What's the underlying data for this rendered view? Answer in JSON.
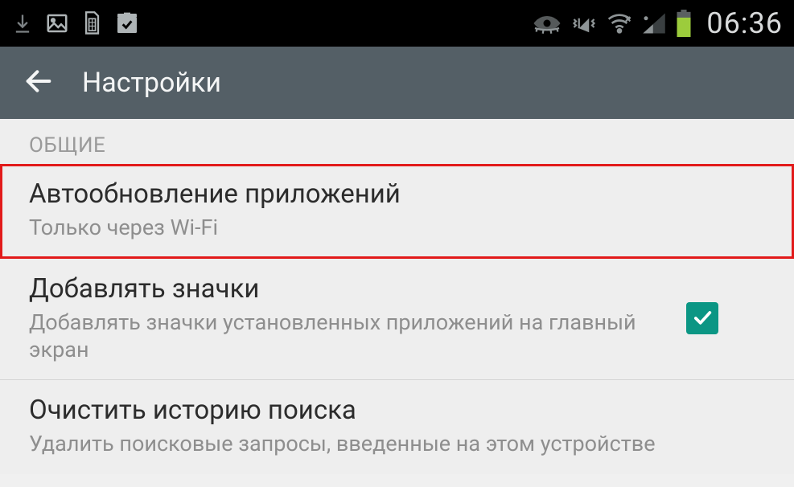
{
  "statusbar": {
    "time": "06:36"
  },
  "header": {
    "title": "Настройки"
  },
  "section": {
    "label": "ОБЩИЕ"
  },
  "items": [
    {
      "title": "Автообновление приложений",
      "subtitle": "Только через Wi-Fi",
      "highlighted": true,
      "checked": false
    },
    {
      "title": "Добавлять значки",
      "subtitle": "Добавлять значки установленных приложений на главный экран",
      "highlighted": false,
      "checked": true
    },
    {
      "title": "Очистить историю поиска",
      "subtitle": "Удалить поисковые запросы, введенные на этом устройстве",
      "highlighted": false,
      "checked": false
    }
  ]
}
